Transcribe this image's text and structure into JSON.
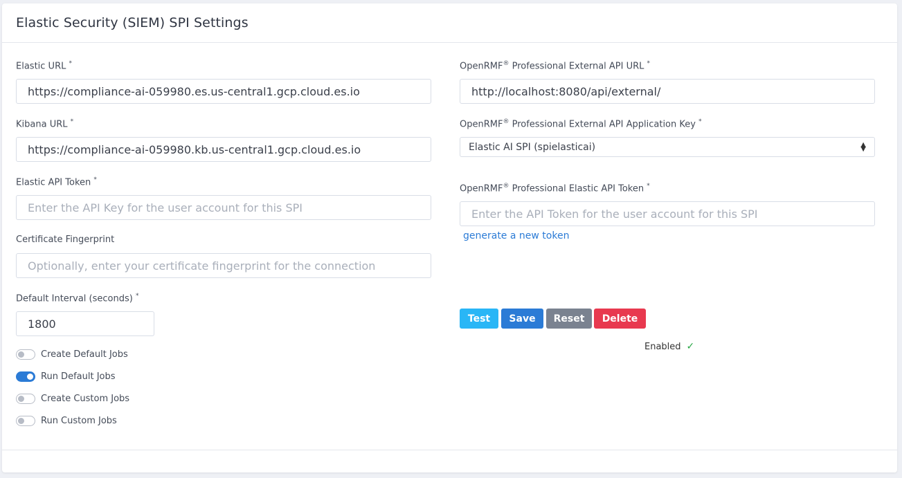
{
  "title": "Elastic Security (SIEM) SPI Settings",
  "left": {
    "elastic_url": {
      "label": "Elastic URL",
      "required": "*",
      "value": "https://compliance-ai-059980.es.us-central1.gcp.cloud.es.io"
    },
    "kibana_url": {
      "label": "Kibana URL",
      "required": "*",
      "value": "https://compliance-ai-059980.kb.us-central1.gcp.cloud.es.io"
    },
    "api_token": {
      "label": "Elastic API Token",
      "required": "*",
      "placeholder": "Enter the API Key for the user account for this SPI"
    },
    "fingerprint": {
      "label": "Certificate Fingerprint",
      "placeholder": "Optionally, enter your certificate fingerprint for the connection"
    },
    "interval": {
      "label": "Default Interval (seconds)",
      "required": "*",
      "value": "1800"
    },
    "toggles": [
      {
        "label": "Create Default Jobs",
        "on": false
      },
      {
        "label": "Run Default Jobs",
        "on": true
      },
      {
        "label": "Create Custom Jobs",
        "on": false
      },
      {
        "label": "Run Custom Jobs",
        "on": false
      }
    ]
  },
  "right": {
    "ext_url": {
      "label_pre": "OpenRMF",
      "reg": "®",
      "label_post": " Professional External API URL",
      "required": "*",
      "value": "http://localhost:8080/api/external/"
    },
    "app_key": {
      "label_pre": "OpenRMF",
      "reg": "®",
      "label_post": " Professional External API Application Key",
      "required": "*",
      "selected": "Elastic AI SPI (spielasticai)"
    },
    "elastic_token": {
      "label_pre": "OpenRMF",
      "reg": "®",
      "label_post": " Professional Elastic API Token",
      "required": "*",
      "placeholder": "Enter the API Token for the user account for this SPI"
    },
    "generate_link": "generate a new token"
  },
  "buttons": {
    "test": {
      "label": "Test",
      "color": "#29b6f6"
    },
    "save": {
      "label": "Save",
      "color": "#2b7bd6"
    },
    "reset": {
      "label": "Reset",
      "color": "#7a8290"
    },
    "delete": {
      "label": "Delete",
      "color": "#e8394f"
    }
  },
  "status": {
    "label": "Enabled",
    "icon": "check-icon",
    "color": "#28a745"
  }
}
